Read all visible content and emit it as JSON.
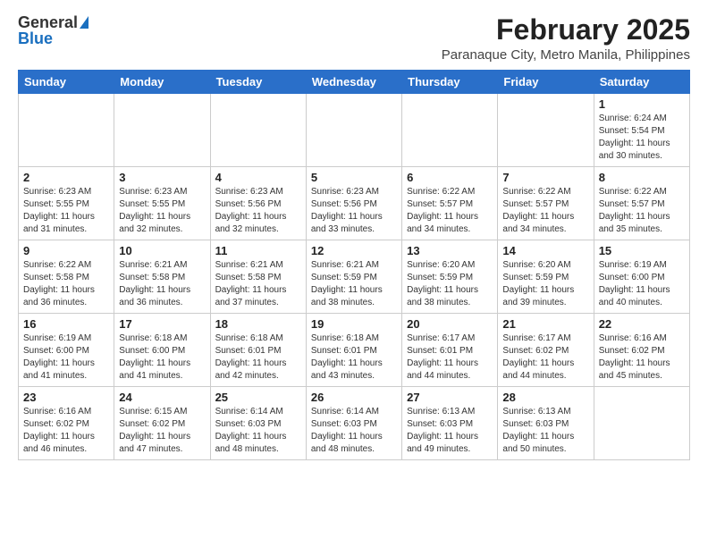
{
  "header": {
    "logo_general": "General",
    "logo_blue": "Blue",
    "month_title": "February 2025",
    "location": "Paranaque City, Metro Manila, Philippines"
  },
  "days_of_week": [
    "Sunday",
    "Monday",
    "Tuesday",
    "Wednesday",
    "Thursday",
    "Friday",
    "Saturday"
  ],
  "weeks": [
    [
      {
        "day": "",
        "info": ""
      },
      {
        "day": "",
        "info": ""
      },
      {
        "day": "",
        "info": ""
      },
      {
        "day": "",
        "info": ""
      },
      {
        "day": "",
        "info": ""
      },
      {
        "day": "",
        "info": ""
      },
      {
        "day": "1",
        "info": "Sunrise: 6:24 AM\nSunset: 5:54 PM\nDaylight: 11 hours\nand 30 minutes."
      }
    ],
    [
      {
        "day": "2",
        "info": "Sunrise: 6:23 AM\nSunset: 5:55 PM\nDaylight: 11 hours\nand 31 minutes."
      },
      {
        "day": "3",
        "info": "Sunrise: 6:23 AM\nSunset: 5:55 PM\nDaylight: 11 hours\nand 32 minutes."
      },
      {
        "day": "4",
        "info": "Sunrise: 6:23 AM\nSunset: 5:56 PM\nDaylight: 11 hours\nand 32 minutes."
      },
      {
        "day": "5",
        "info": "Sunrise: 6:23 AM\nSunset: 5:56 PM\nDaylight: 11 hours\nand 33 minutes."
      },
      {
        "day": "6",
        "info": "Sunrise: 6:22 AM\nSunset: 5:57 PM\nDaylight: 11 hours\nand 34 minutes."
      },
      {
        "day": "7",
        "info": "Sunrise: 6:22 AM\nSunset: 5:57 PM\nDaylight: 11 hours\nand 34 minutes."
      },
      {
        "day": "8",
        "info": "Sunrise: 6:22 AM\nSunset: 5:57 PM\nDaylight: 11 hours\nand 35 minutes."
      }
    ],
    [
      {
        "day": "9",
        "info": "Sunrise: 6:22 AM\nSunset: 5:58 PM\nDaylight: 11 hours\nand 36 minutes."
      },
      {
        "day": "10",
        "info": "Sunrise: 6:21 AM\nSunset: 5:58 PM\nDaylight: 11 hours\nand 36 minutes."
      },
      {
        "day": "11",
        "info": "Sunrise: 6:21 AM\nSunset: 5:58 PM\nDaylight: 11 hours\nand 37 minutes."
      },
      {
        "day": "12",
        "info": "Sunrise: 6:21 AM\nSunset: 5:59 PM\nDaylight: 11 hours\nand 38 minutes."
      },
      {
        "day": "13",
        "info": "Sunrise: 6:20 AM\nSunset: 5:59 PM\nDaylight: 11 hours\nand 38 minutes."
      },
      {
        "day": "14",
        "info": "Sunrise: 6:20 AM\nSunset: 5:59 PM\nDaylight: 11 hours\nand 39 minutes."
      },
      {
        "day": "15",
        "info": "Sunrise: 6:19 AM\nSunset: 6:00 PM\nDaylight: 11 hours\nand 40 minutes."
      }
    ],
    [
      {
        "day": "16",
        "info": "Sunrise: 6:19 AM\nSunset: 6:00 PM\nDaylight: 11 hours\nand 41 minutes."
      },
      {
        "day": "17",
        "info": "Sunrise: 6:18 AM\nSunset: 6:00 PM\nDaylight: 11 hours\nand 41 minutes."
      },
      {
        "day": "18",
        "info": "Sunrise: 6:18 AM\nSunset: 6:01 PM\nDaylight: 11 hours\nand 42 minutes."
      },
      {
        "day": "19",
        "info": "Sunrise: 6:18 AM\nSunset: 6:01 PM\nDaylight: 11 hours\nand 43 minutes."
      },
      {
        "day": "20",
        "info": "Sunrise: 6:17 AM\nSunset: 6:01 PM\nDaylight: 11 hours\nand 44 minutes."
      },
      {
        "day": "21",
        "info": "Sunrise: 6:17 AM\nSunset: 6:02 PM\nDaylight: 11 hours\nand 44 minutes."
      },
      {
        "day": "22",
        "info": "Sunrise: 6:16 AM\nSunset: 6:02 PM\nDaylight: 11 hours\nand 45 minutes."
      }
    ],
    [
      {
        "day": "23",
        "info": "Sunrise: 6:16 AM\nSunset: 6:02 PM\nDaylight: 11 hours\nand 46 minutes."
      },
      {
        "day": "24",
        "info": "Sunrise: 6:15 AM\nSunset: 6:02 PM\nDaylight: 11 hours\nand 47 minutes."
      },
      {
        "day": "25",
        "info": "Sunrise: 6:14 AM\nSunset: 6:03 PM\nDaylight: 11 hours\nand 48 minutes."
      },
      {
        "day": "26",
        "info": "Sunrise: 6:14 AM\nSunset: 6:03 PM\nDaylight: 11 hours\nand 48 minutes."
      },
      {
        "day": "27",
        "info": "Sunrise: 6:13 AM\nSunset: 6:03 PM\nDaylight: 11 hours\nand 49 minutes."
      },
      {
        "day": "28",
        "info": "Sunrise: 6:13 AM\nSunset: 6:03 PM\nDaylight: 11 hours\nand 50 minutes."
      },
      {
        "day": "",
        "info": ""
      }
    ]
  ]
}
